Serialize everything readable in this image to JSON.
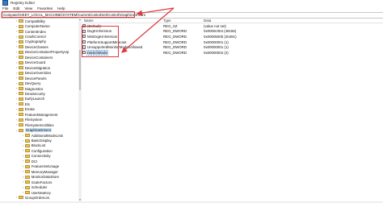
{
  "window": {
    "title": "Registry Editor"
  },
  "menu": [
    "File",
    "Edit",
    "View",
    "Favorites",
    "Help"
  ],
  "address": {
    "path": "Computer\\HKEY_LOCAL_MACHINE\\SYSTEM\\CurrentControlSet\\Control\\GraphicsDrivers"
  },
  "tree": [
    {
      "label": "Compatibility",
      "expandable": true
    },
    {
      "label": "ComputerName",
      "expandable": true
    },
    {
      "label": "ContentIndex",
      "expandable": true
    },
    {
      "label": "CrashControl",
      "expandable": true
    },
    {
      "label": "Cryptography",
      "expandable": true
    },
    {
      "label": "DeviceClasses",
      "expandable": true
    },
    {
      "label": "DeviceContainerPropertyUp",
      "expandable": true
    },
    {
      "label": "DeviceContainers",
      "expandable": true
    },
    {
      "label": "DeviceGuard",
      "expandable": true
    },
    {
      "label": "DeviceMigration",
      "expandable": true
    },
    {
      "label": "DeviceOverrides",
      "expandable": true
    },
    {
      "label": "DevicePanels",
      "expandable": true
    },
    {
      "label": "DevQuery",
      "expandable": true
    },
    {
      "label": "Diagnostics",
      "expandable": true
    },
    {
      "label": "DmaSecurity",
      "expandable": true
    },
    {
      "label": "EarlyLaunch",
      "expandable": true
    },
    {
      "label": "Els",
      "expandable": true
    },
    {
      "label": "Errata",
      "expandable": true
    },
    {
      "label": "FeatureManagement",
      "expandable": true
    },
    {
      "label": "FileSystem",
      "expandable": true
    },
    {
      "label": "FileSystemUtilities",
      "expandable": true
    },
    {
      "label": "GraphicsDrivers",
      "expandable": true,
      "expanded": true,
      "selected": true
    },
    {
      "label": "AdditionalModeLists",
      "expandable": true,
      "child": true
    },
    {
      "label": "BasicDisplay",
      "expandable": true,
      "child": true
    },
    {
      "label": "BlockList",
      "expandable": true,
      "child": true
    },
    {
      "label": "Configuration",
      "expandable": true,
      "child": true
    },
    {
      "label": "Connectivity",
      "expandable": true,
      "child": true
    },
    {
      "label": "DCI",
      "expandable": true,
      "child": true
    },
    {
      "label": "FeatureSetUsage",
      "expandable": true,
      "child": true
    },
    {
      "label": "MemoryManager",
      "expandable": true,
      "child": true
    },
    {
      "label": "MonitorDataStore",
      "expandable": true,
      "child": true
    },
    {
      "label": "ScaleFactors",
      "expandable": true,
      "child": true
    },
    {
      "label": "Scheduler",
      "expandable": true,
      "child": true
    },
    {
      "label": "UseNewKey",
      "expandable": true,
      "child": true
    },
    {
      "label": "GroupOrderList",
      "expandable": true
    }
  ],
  "list": {
    "headers": {
      "name": "Name",
      "type": "Type",
      "data": "Data"
    },
    "values": [
      {
        "name": "(Default)",
        "type": "REG_SZ",
        "data": "(value not set)",
        "icon": "string-value-icon"
      },
      {
        "name": "DxgKrnlVersion",
        "type": "REG_DWORD",
        "data": "0x0000c004 (49156)",
        "icon": "dword-value-icon"
      },
      {
        "name": "MinDxgKrnlVersion",
        "type": "REG_DWORD",
        "data": "0x0000500b (20491)",
        "icon": "dword-value-icon"
      },
      {
        "name": "PlatformSupportMiracast",
        "type": "REG_DWORD",
        "data": "0x00000001 (1)",
        "icon": "dword-value-icon"
      },
      {
        "name": "UnsupportedMonitorModesAllowed",
        "type": "REG_DWORD",
        "data": "0x00000001 (1)",
        "icon": "dword-value-icon"
      },
      {
        "name": "HwSchMode",
        "type": "REG_DWORD",
        "data": "0x00000002 (2)",
        "icon": "dword-value-icon",
        "selected": true
      }
    ]
  },
  "colors": {
    "highlight": "#e0383e",
    "selection": "#cce4f7",
    "folder": "#e7c35a"
  }
}
